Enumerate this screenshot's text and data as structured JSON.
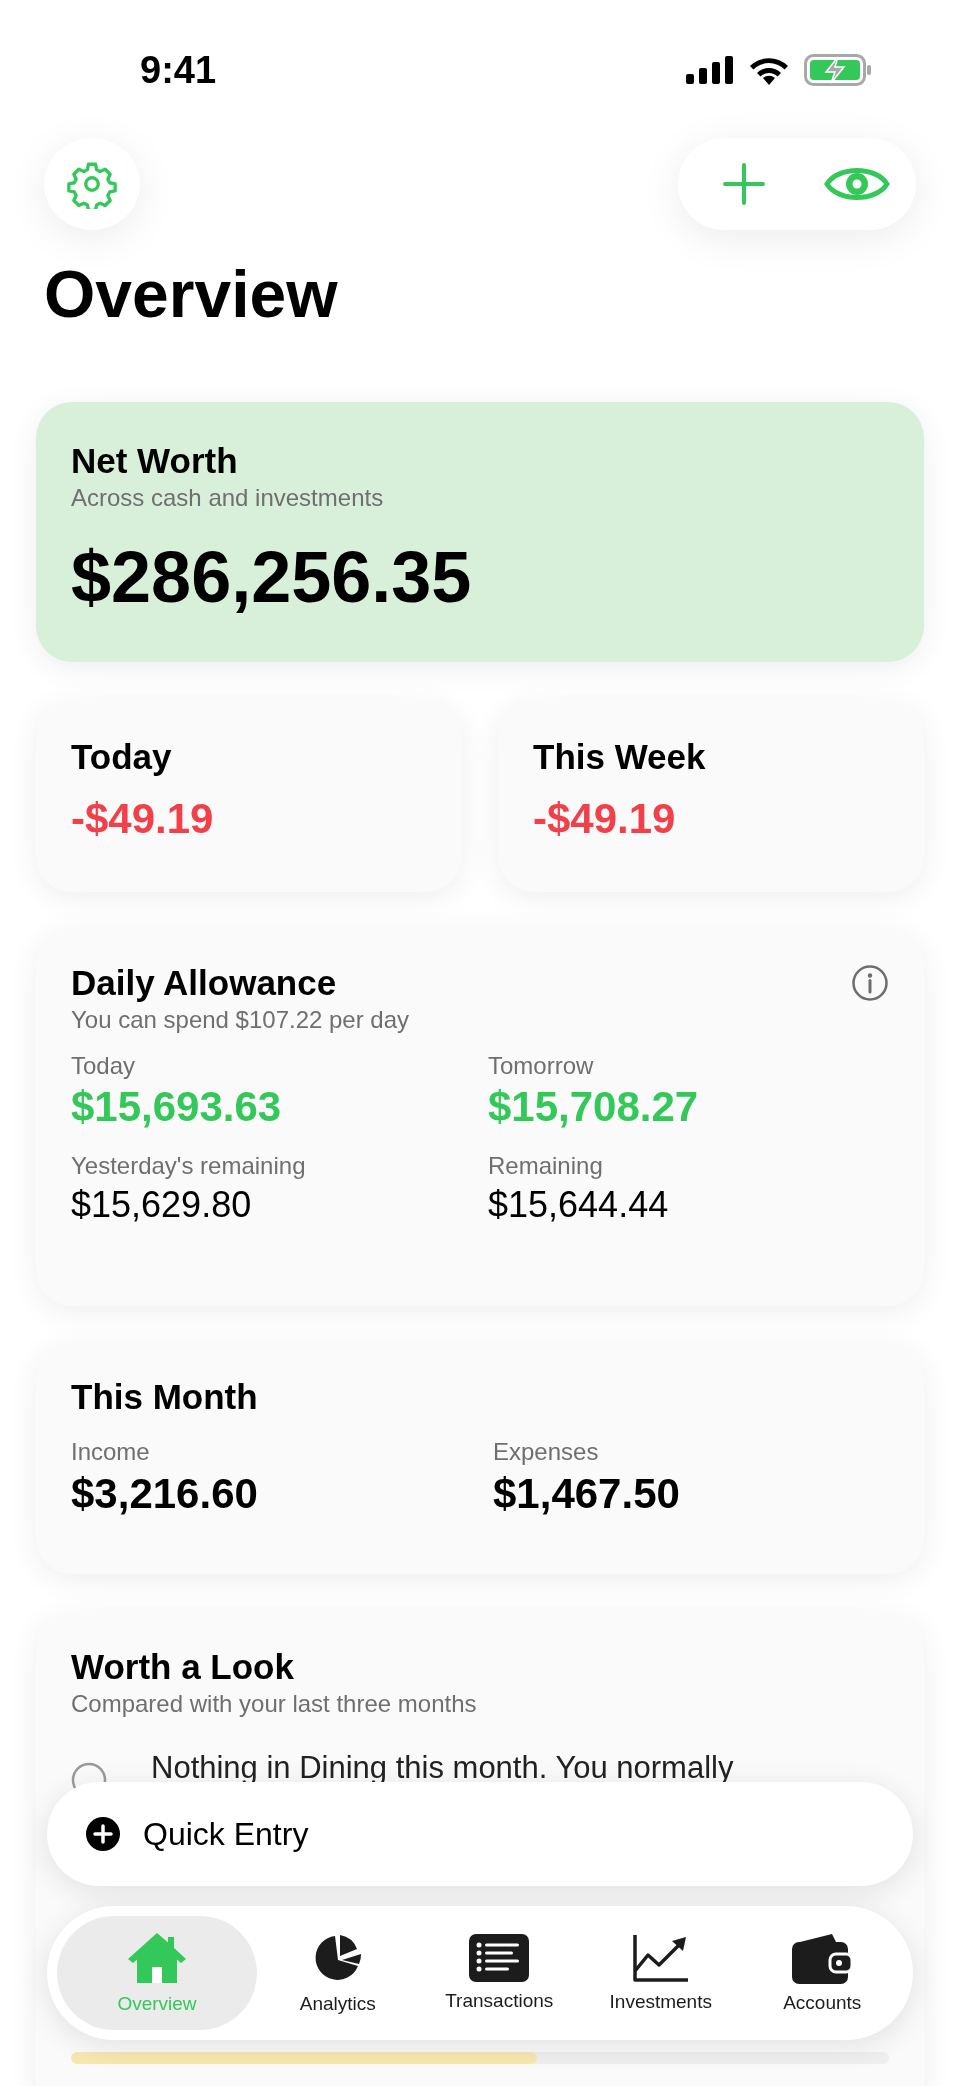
{
  "status_bar": {
    "time": "9:41"
  },
  "header": {
    "title": "Overview"
  },
  "net_worth": {
    "title": "Net Worth",
    "subtitle": "Across cash and investments",
    "amount": "$286,256.35"
  },
  "period_cards": [
    {
      "title": "Today",
      "amount": "-$49.19"
    },
    {
      "title": "This Week",
      "amount": "-$49.19"
    }
  ],
  "daily_allowance": {
    "title": "Daily Allowance",
    "subtitle": "You can spend $107.22 per day",
    "stats": [
      {
        "label": "Today",
        "value": "$15,693.63",
        "kind": "highlight"
      },
      {
        "label": "Tomorrow",
        "value": "$15,708.27",
        "kind": "highlight"
      },
      {
        "label": "Yesterday's remaining",
        "value": "$15,629.80",
        "kind": "plain"
      },
      {
        "label": "Remaining",
        "value": "$15,644.44",
        "kind": "plain"
      }
    ]
  },
  "this_month": {
    "title": "This Month",
    "stats": [
      {
        "label": "Income",
        "value": "$3,216.60"
      },
      {
        "label": "Expenses",
        "value": "$1,467.50"
      }
    ]
  },
  "worth_a_look": {
    "title": "Worth a Look",
    "subtitle": "Compared with your last three months",
    "insight": "Nothing in Dining this month. You normally",
    "budget": {
      "level": 0.57
    }
  },
  "quick_entry": {
    "label": "Quick Entry"
  },
  "tabs": [
    {
      "label": "Overview",
      "selected": true
    },
    {
      "label": "Analytics",
      "selected": false
    },
    {
      "label": "Transactions",
      "selected": false
    },
    {
      "label": "Investments",
      "selected": false
    },
    {
      "label": "Accounts",
      "selected": false
    }
  ]
}
